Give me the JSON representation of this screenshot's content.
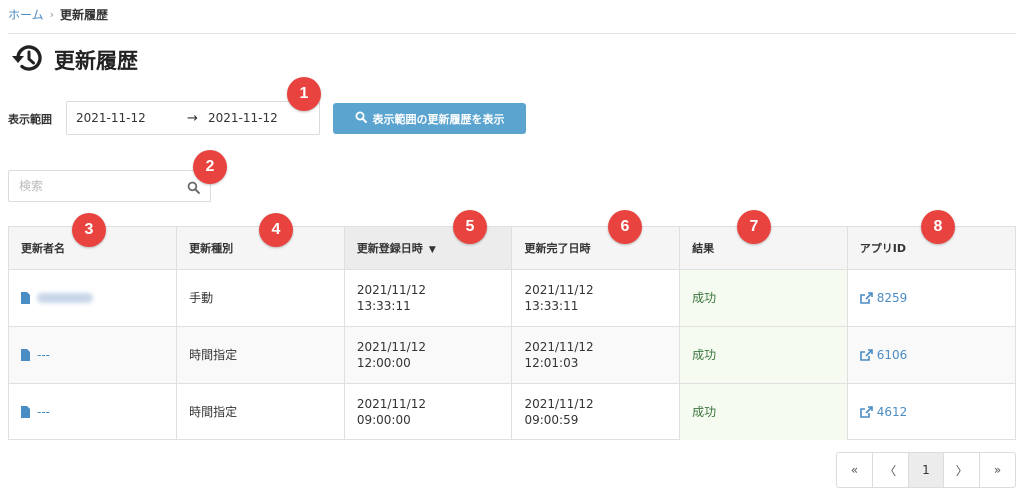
{
  "breadcrumb": {
    "home": "ホーム",
    "separator": "›",
    "current": "更新履歴"
  },
  "page": {
    "title": "更新履歴",
    "title_icon": "history-icon"
  },
  "range": {
    "label": "表示範囲",
    "start": "2021-11-12",
    "arrow": "→",
    "end": "2021-11-12",
    "button_label": "表示範囲の更新履歴を表示"
  },
  "search": {
    "placeholder": "検索"
  },
  "table": {
    "columns": [
      "更新者名",
      "更新種別",
      "更新登録日時",
      "更新完了日時",
      "結果",
      "アプリID"
    ],
    "rows": [
      {
        "name": "",
        "type": "手動",
        "registered": [
          "2021/11/12",
          "13:33:11"
        ],
        "completed": [
          "2021/11/12",
          "13:33:11"
        ],
        "result": "成功",
        "app_id": "8259"
      },
      {
        "name": "---",
        "type": "時間指定",
        "registered": [
          "2021/11/12",
          "12:00:00"
        ],
        "completed": [
          "2021/11/12",
          "12:01:03"
        ],
        "result": "成功",
        "app_id": "6106"
      },
      {
        "name": "---",
        "type": "時間指定",
        "registered": [
          "2021/11/12",
          "09:00:00"
        ],
        "completed": [
          "2021/11/12",
          "09:00:59"
        ],
        "result": "成功",
        "app_id": "4612"
      }
    ]
  },
  "badges": [
    "1",
    "2",
    "3",
    "4",
    "5",
    "6",
    "7",
    "8"
  ],
  "pagination": {
    "first": "«",
    "prev": "〈",
    "current": "1",
    "next": "〉",
    "last": "»"
  },
  "colors": {
    "accent": "#5aa4cf",
    "link": "#4a8cc4",
    "badge": "#e8433e",
    "success_bg": "#f6fbf1",
    "success_text": "#3c763d"
  }
}
